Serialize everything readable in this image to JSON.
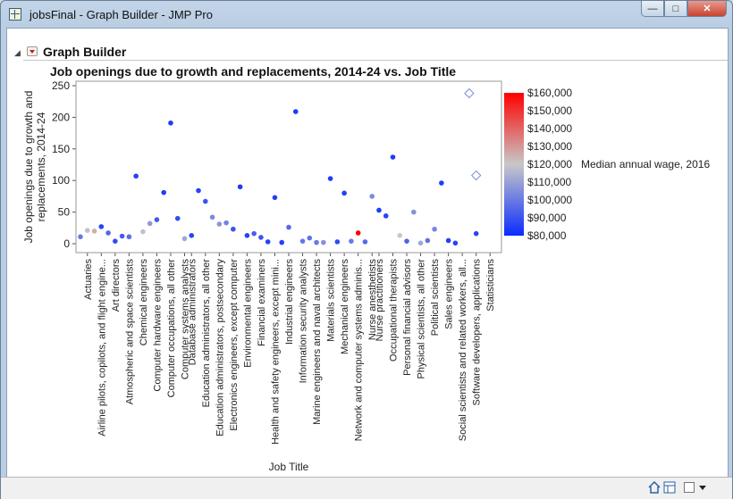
{
  "window": {
    "title": "jobsFinal - Graph Builder - JMP Pro",
    "minimize_glyph": "—",
    "maximize_glyph": "□",
    "close_glyph": "✕"
  },
  "panel": {
    "title": "Graph Builder",
    "disclosure_glyph": "◢"
  },
  "chart_data": {
    "type": "scatter",
    "title": "Job openings due to growth and replacements, 2014-24 vs. Job Title",
    "ylabel_lines": [
      "Job openings due to growth and",
      "replacements, 2014-24"
    ],
    "xlabel": "Job Title",
    "ylim": [
      0,
      250
    ],
    "yticks": [
      0,
      50,
      100,
      150,
      200,
      250
    ],
    "grid": false,
    "x_tick_labels": [
      "Actuaries",
      "Airline pilots, copilots, and flight engine...",
      "Art directors",
      "Atmospheric and space scientists",
      "Chemical engineers",
      "Computer hardware engineers",
      "Computer occupations, all other",
      "Computer systems analysts",
      "Database administrators",
      "Education administrators, all other",
      "Education administrators, postsecondary",
      "Electronics engineers, except computer",
      "Environmental engineers",
      "Financial examiners",
      "Health and safety engineers, except mini...",
      "Industrial engineers",
      "Information security analysts",
      "Marine engineers and naval architects",
      "Materials scientists",
      "Mechanical engineers",
      "Network and computer systems adminis...",
      "Nurse anesthetists",
      "Nurse practitioners",
      "Occupational therapists",
      "Personal financial advisors",
      "Physical scientists, all other",
      "Political scientists",
      "Sales engineers",
      "Social scientists and related workers, all...",
      "Software developers, applications",
      "Statisticians"
    ],
    "x_tick_positions": [
      1,
      3,
      5,
      7,
      9,
      11,
      13,
      15,
      16,
      18,
      20,
      22,
      24,
      26,
      28,
      30,
      32,
      34,
      36,
      38,
      40,
      42,
      43,
      45,
      47,
      49,
      51,
      53,
      55,
      57,
      59
    ],
    "x_domain": [
      0,
      60
    ],
    "points": [
      {
        "x": 0,
        "y": 11,
        "wage": 100000
      },
      {
        "x": 1,
        "y": 21,
        "wage": 118000
      },
      {
        "x": 2,
        "y": 20,
        "wage": 125000
      },
      {
        "x": 3,
        "y": 27,
        "wage": 86000
      },
      {
        "x": 4,
        "y": 17,
        "wage": 95000
      },
      {
        "x": 5,
        "y": 4,
        "wage": 88000
      },
      {
        "x": 6,
        "y": 12,
        "wage": 92000
      },
      {
        "x": 7,
        "y": 11,
        "wage": 97000
      },
      {
        "x": 8,
        "y": 107,
        "wage": 85000
      },
      {
        "x": 9,
        "y": 19,
        "wage": 118000
      },
      {
        "x": 10,
        "y": 32,
        "wage": 108000
      },
      {
        "x": 11,
        "y": 38,
        "wage": 92000
      },
      {
        "x": 12,
        "y": 81,
        "wage": 84000
      },
      {
        "x": 13,
        "y": 191,
        "wage": 84000
      },
      {
        "x": 14,
        "y": 40,
        "wage": 88000
      },
      {
        "x": 15,
        "y": 8,
        "wage": 112000
      },
      {
        "x": 16,
        "y": 13,
        "wage": 86000
      },
      {
        "x": 17,
        "y": 84,
        "wage": 86000
      },
      {
        "x": 18,
        "y": 67,
        "wage": 90000
      },
      {
        "x": 19,
        "y": 42,
        "wage": 104000
      },
      {
        "x": 20,
        "y": 31,
        "wage": 107000
      },
      {
        "x": 21,
        "y": 33,
        "wage": 102000
      },
      {
        "x": 22,
        "y": 23,
        "wage": 90000
      },
      {
        "x": 23,
        "y": 90,
        "wage": 84000
      },
      {
        "x": 24,
        "y": 13,
        "wage": 86000
      },
      {
        "x": 25,
        "y": 16,
        "wage": 93000
      },
      {
        "x": 26,
        "y": 10,
        "wage": 90000
      },
      {
        "x": 27,
        "y": 3,
        "wage": 86000
      },
      {
        "x": 28,
        "y": 73,
        "wage": 85000
      },
      {
        "x": 29,
        "y": 2,
        "wage": 85000
      },
      {
        "x": 30,
        "y": 26,
        "wage": 96000
      },
      {
        "x": 31,
        "y": 209,
        "wage": 84000
      },
      {
        "x": 32,
        "y": 4,
        "wage": 99000
      },
      {
        "x": 33,
        "y": 9,
        "wage": 98000
      },
      {
        "x": 34,
        "y": 2,
        "wage": 100000
      },
      {
        "x": 35,
        "y": 2,
        "wage": 106000
      },
      {
        "x": 36,
        "y": 103,
        "wage": 84000
      },
      {
        "x": 37,
        "y": 3,
        "wage": 88000
      },
      {
        "x": 38,
        "y": 80,
        "wage": 85000
      },
      {
        "x": 39,
        "y": 4,
        "wage": 100000
      },
      {
        "x": 40,
        "y": 17,
        "wage": 160000
      },
      {
        "x": 41,
        "y": 3,
        "wage": 96000
      },
      {
        "x": 42,
        "y": 75,
        "wage": 104000
      },
      {
        "x": 43,
        "y": 53,
        "wage": 84000
      },
      {
        "x": 44,
        "y": 44,
        "wage": 86000
      },
      {
        "x": 45,
        "y": 137,
        "wage": 84000
      },
      {
        "x": 46,
        "y": 13,
        "wage": 120000
      },
      {
        "x": 47,
        "y": 4,
        "wage": 94000
      },
      {
        "x": 48,
        "y": 50,
        "wage": 106000
      },
      {
        "x": 49,
        "y": 1,
        "wage": 112000
      },
      {
        "x": 50,
        "y": 5,
        "wage": 98000
      },
      {
        "x": 51,
        "y": 23,
        "wage": 103000
      },
      {
        "x": 52,
        "y": 96,
        "wage": 84000
      },
      {
        "x": 53,
        "y": 5,
        "wage": 85000
      },
      {
        "x": 54,
        "y": 1,
        "wage": 86000
      },
      {
        "x": 57,
        "y": 16,
        "wage": 86000
      }
    ],
    "outliers": [
      {
        "x": 56,
        "y": 238
      },
      {
        "x": 57,
        "y": 108
      }
    ],
    "color_legend": {
      "title": "Median annual wage, 2016",
      "title_at_value": 120000,
      "min": 80000,
      "max": 160000,
      "labels": [
        "$160,000",
        "$150,000",
        "$140,000",
        "$130,000",
        "$120,000",
        "$110,000",
        "$100,000",
        "$90,000",
        "$80,000"
      ],
      "values": [
        160000,
        150000,
        140000,
        130000,
        120000,
        110000,
        100000,
        90000,
        80000
      ],
      "colors": {
        "low": "#0b2cff",
        "mid": "#c8c8c8",
        "high": "#ff0000"
      }
    },
    "marker_color_outlier": "#7c8ed4"
  },
  "statusbar": {
    "icons": [
      "home-icon",
      "layout-icon",
      "checkbox-icon",
      "dropdown-icon"
    ]
  }
}
